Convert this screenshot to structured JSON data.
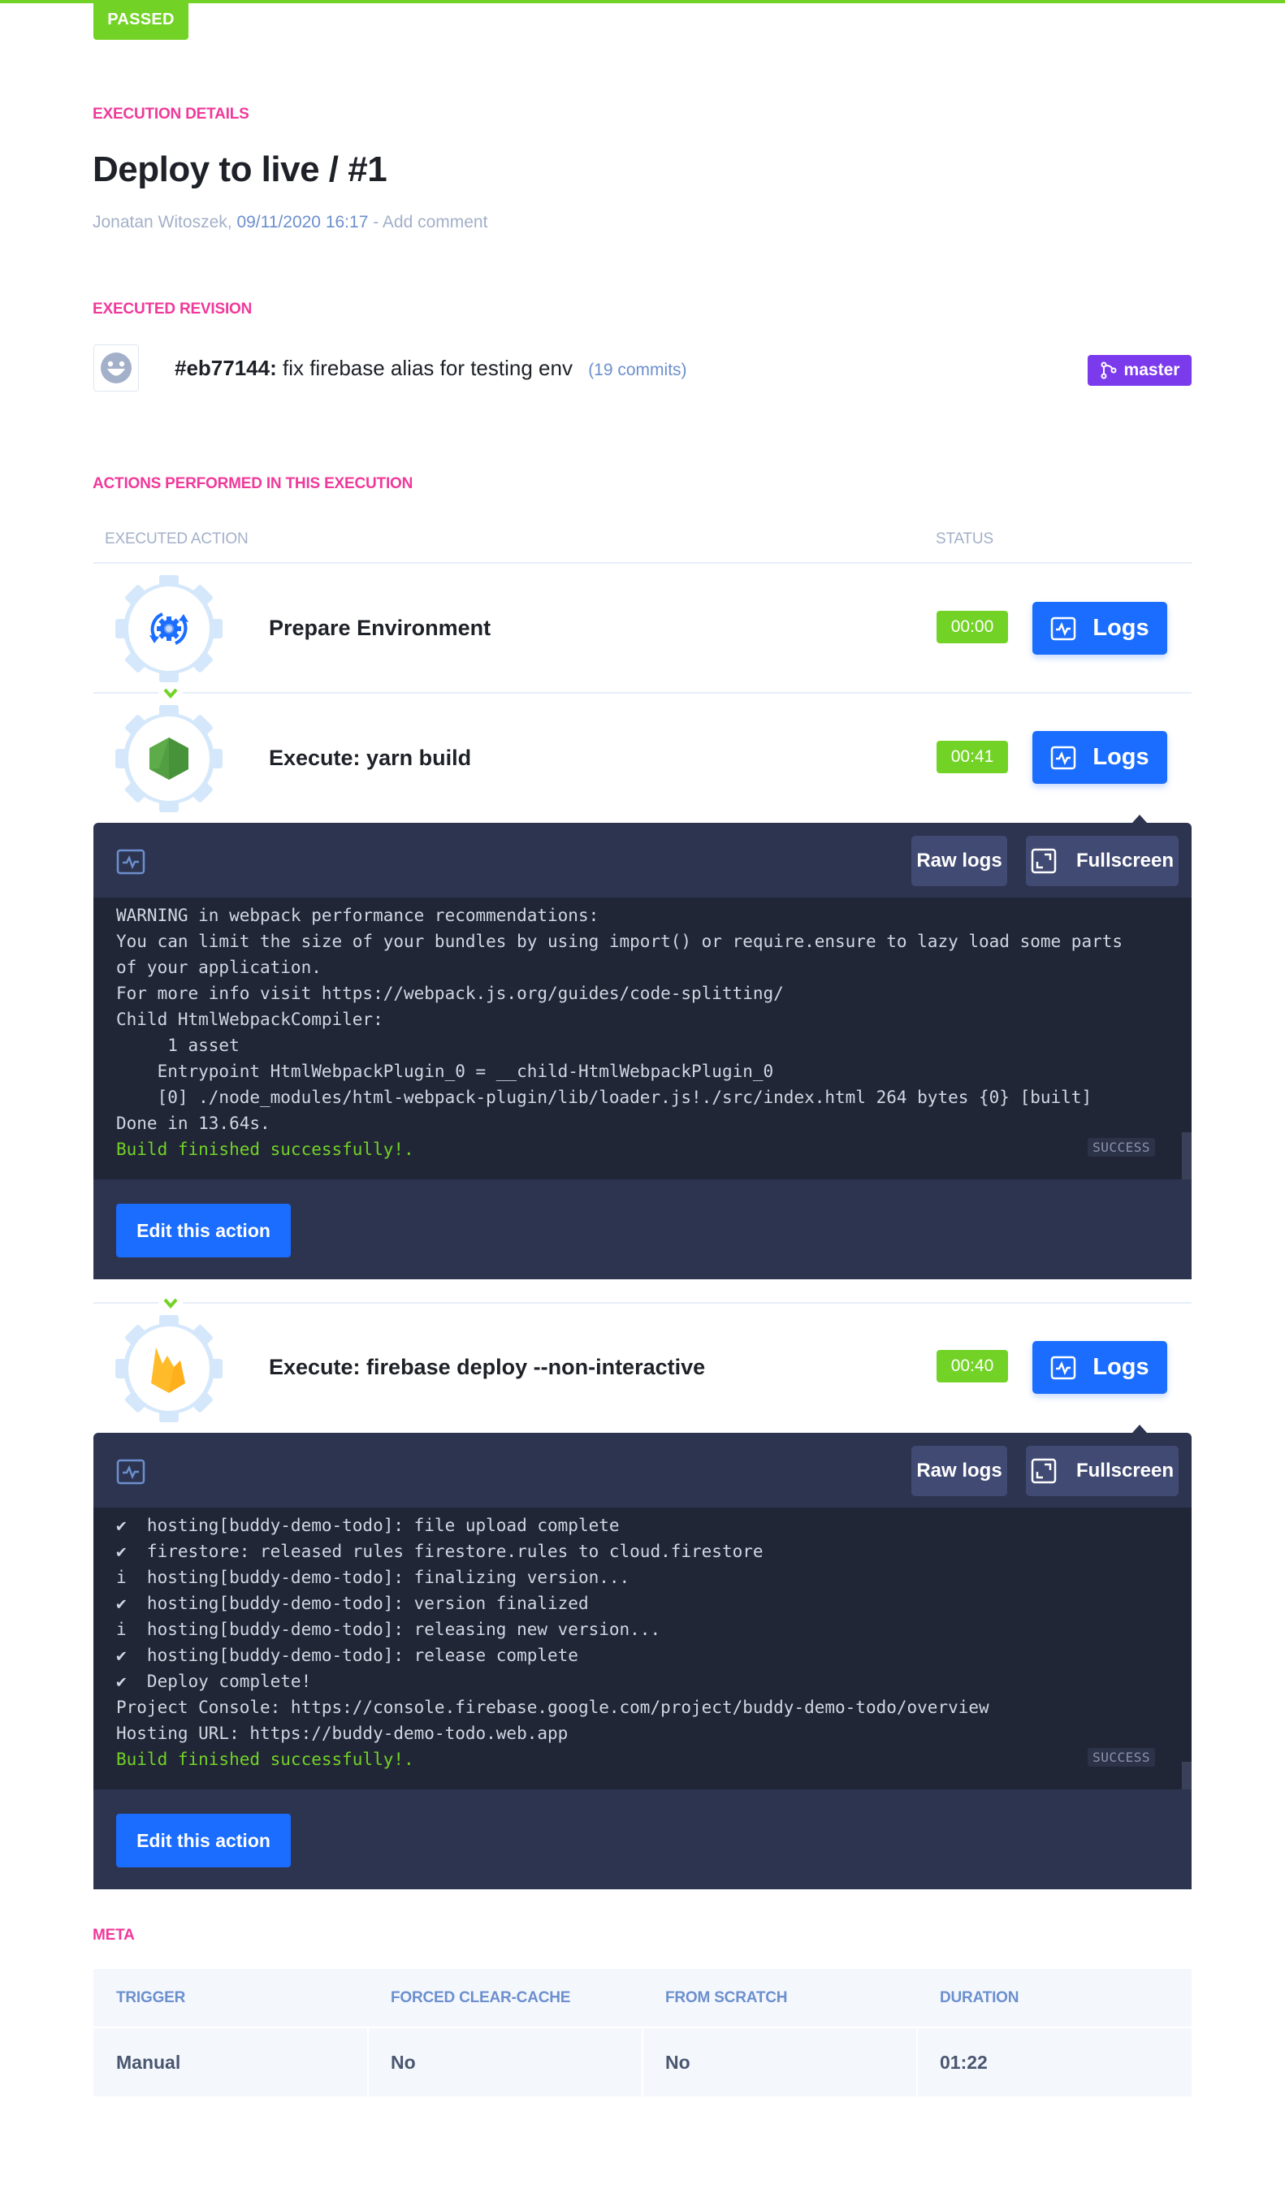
{
  "status_badge": "PASSED",
  "colors": {
    "success": "#72d225",
    "accent_pink": "#f0399a",
    "primary_blue": "#1a6dff",
    "branch_purple": "#7c3aed",
    "log_panel": "#2d3450",
    "log_body": "#212637"
  },
  "execution": {
    "section_label": "EXECUTION DETAILS",
    "title": "Deploy to live / #1",
    "author": "Jonatan Witoszek,",
    "datetime": "09/11/2020 16:17",
    "separator": " - ",
    "add_comment": "Add comment"
  },
  "revision": {
    "section_label": "EXECUTED REVISION",
    "avatar_icon": "smiley-face-icon",
    "hash": "#eb77144:",
    "message": " fix firebase alias for testing env",
    "commits": "(19 commits)",
    "branch": "master",
    "branch_icon": "git-branch-icon"
  },
  "actions": {
    "section_label": "ACTIONS PERFORMED IN THIS EXECUTION",
    "col_action": "EXECUTED ACTION",
    "col_status": "STATUS",
    "items": [
      {
        "name": "Prepare Environment",
        "icon": "environment-gear-icon",
        "time": "00:00",
        "logs_label": "Logs"
      },
      {
        "name": "Execute: yarn build",
        "icon": "nodejs-icon",
        "time": "00:41",
        "logs_label": "Logs",
        "log": {
          "raw_logs_label": "Raw logs",
          "fullscreen_label": "Fullscreen",
          "status_tag": "SUCCESS",
          "edit_label": "Edit this action",
          "lines": [
            "WARNING in webpack performance recommendations:",
            "You can limit the size of your bundles by using import() or require.ensure to lazy load some parts",
            "of your application.",
            "For more info visit https://webpack.js.org/guides/code-splitting/",
            "Child HtmlWebpackCompiler:",
            "     1 asset",
            "    Entrypoint HtmlWebpackPlugin_0 = __child-HtmlWebpackPlugin_0",
            "    [0] ./node_modules/html-webpack-plugin/lib/loader.js!./src/index.html 264 bytes {0} [built]",
            "Done in 13.64s.",
            "Build finished successfully!."
          ]
        }
      },
      {
        "name": "Execute: firebase deploy --non-interactive",
        "icon": "firebase-icon",
        "time": "00:40",
        "logs_label": "Logs",
        "log": {
          "raw_logs_label": "Raw logs",
          "fullscreen_label": "Fullscreen",
          "status_tag": "SUCCESS",
          "edit_label": "Edit this action",
          "lines": [
            "✔  hosting[buddy-demo-todo]: file upload complete",
            "✔  firestore: released rules firestore.rules to cloud.firestore",
            "i  hosting[buddy-demo-todo]: finalizing version...",
            "✔  hosting[buddy-demo-todo]: version finalized",
            "i  hosting[buddy-demo-todo]: releasing new version...",
            "✔  hosting[buddy-demo-todo]: release complete",
            "✔  Deploy complete!",
            "Project Console: https://console.firebase.google.com/project/buddy-demo-todo/overview",
            "Hosting URL: https://buddy-demo-todo.web.app",
            "Build finished successfully!."
          ]
        }
      }
    ]
  },
  "meta": {
    "section_label": "META",
    "headers": [
      "TRIGGER",
      "FORCED CLEAR-CACHE",
      "FROM SCRATCH",
      "DURATION"
    ],
    "values": [
      "Manual",
      "No",
      "No",
      "01:22"
    ]
  }
}
